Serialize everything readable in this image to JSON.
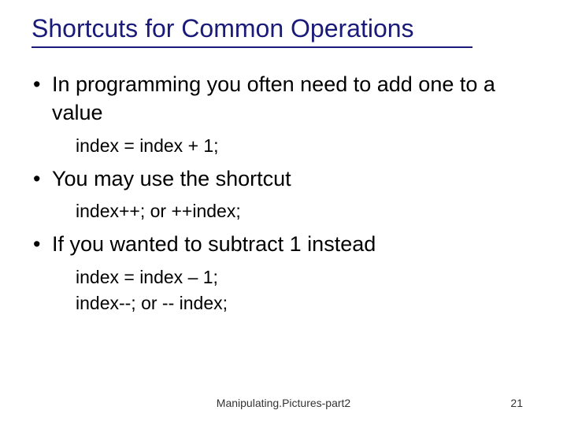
{
  "title": "Shortcuts for Common Operations",
  "bullets": [
    {
      "text": "In programming you often need to add one to a value",
      "sub": [
        "index = index + 1;"
      ]
    },
    {
      "text": "You may use the shortcut",
      "sub": [
        "index++; or ++index;"
      ]
    },
    {
      "text": "If you wanted to subtract 1 instead",
      "sub": [
        "index = index – 1;",
        "index--; or -- index;"
      ]
    }
  ],
  "footer": {
    "center": "Manipulating.Pictures-part2",
    "pageNumber": "21"
  }
}
